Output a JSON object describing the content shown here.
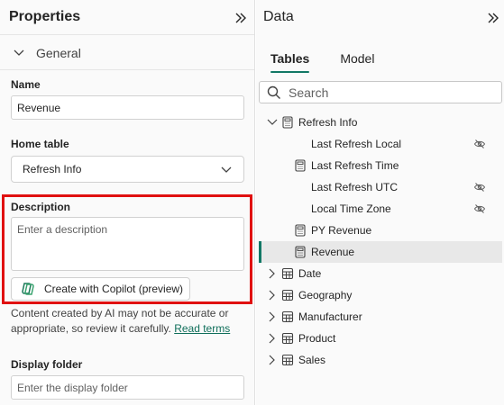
{
  "properties": {
    "title": "Properties",
    "section": "General",
    "name_label": "Name",
    "name_value": "Revenue",
    "home_table_label": "Home table",
    "home_table_value": "Refresh Info",
    "description_label": "Description",
    "description_placeholder": "Enter a description",
    "copilot_button": "Create with Copilot (preview)",
    "ai_note": "Content created by AI may not be accurate or appropriate, so review it carefully.",
    "read_terms": "Read terms",
    "display_folder_label": "Display folder",
    "display_folder_placeholder": "Enter the display folder"
  },
  "data_pane": {
    "title": "Data",
    "tabs": [
      "Tables",
      "Model"
    ],
    "active_tab": "Tables",
    "search_placeholder": "Search",
    "tree": [
      {
        "label": "Refresh Info",
        "type": "table",
        "expanded": true
      },
      {
        "label": "Last Refresh Local",
        "type": "column",
        "hidden": true
      },
      {
        "label": "Last Refresh Time",
        "type": "measure",
        "hidden": false
      },
      {
        "label": "Last Refresh UTC",
        "type": "column",
        "hidden": true
      },
      {
        "label": "Local Time Zone",
        "type": "column",
        "hidden": true
      },
      {
        "label": "PY Revenue",
        "type": "measure",
        "hidden": false
      },
      {
        "label": "Revenue",
        "type": "measure",
        "selected": true
      },
      {
        "label": "Date",
        "type": "table",
        "expanded": false
      },
      {
        "label": "Geography",
        "type": "table",
        "expanded": false
      },
      {
        "label": "Manufacturer",
        "type": "table",
        "expanded": false
      },
      {
        "label": "Product",
        "type": "table",
        "expanded": false
      },
      {
        "label": "Sales",
        "type": "table",
        "expanded": false
      }
    ]
  },
  "colors": {
    "accent": "#117865",
    "highlight_box": "#e01010",
    "link": "#0f6e5a"
  }
}
